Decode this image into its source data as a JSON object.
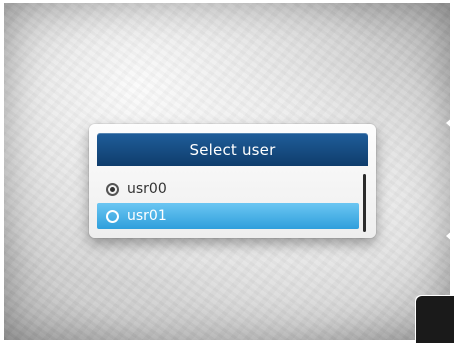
{
  "dialog": {
    "title": "Select user",
    "users": [
      {
        "label": "usr00",
        "checked": true,
        "selected": false
      },
      {
        "label": "usr01",
        "checked": false,
        "selected": true
      }
    ]
  },
  "colors": {
    "header": "#1a4f86",
    "selection": "#3aaae2"
  },
  "icons": {
    "radio": "radio-button-icon",
    "side_arrow": "chevron-left-icon"
  }
}
